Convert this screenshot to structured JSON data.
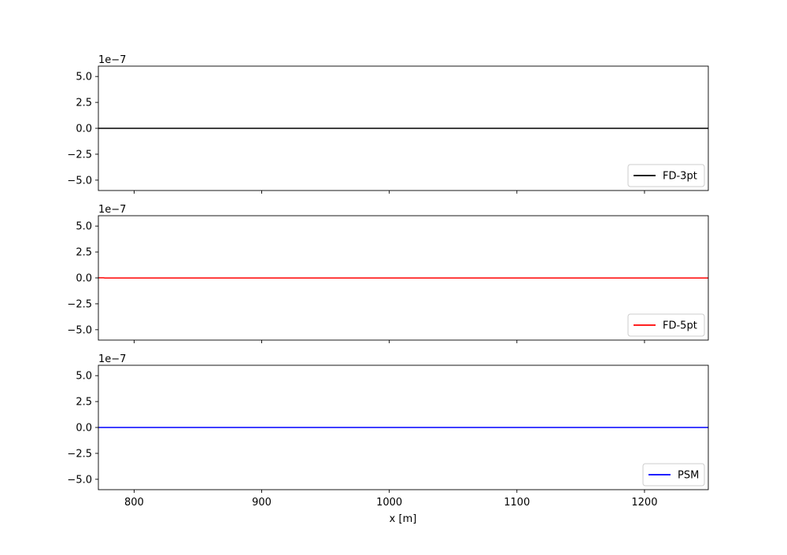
{
  "chart_data": {
    "type": "line",
    "layout": "3 vertically stacked subplots with shared x axis",
    "xlabel": "x [m]",
    "xlim": [
      772,
      1250
    ],
    "xticks": [
      800,
      900,
      1000,
      1100,
      1200
    ],
    "xtick_labels": [
      "800",
      "900",
      "1000",
      "1100",
      "1200"
    ],
    "grid": false,
    "subplots": [
      {
        "offset_text": "1e−7",
        "ylim": [
          -6e-07,
          6e-07
        ],
        "yticks": [
          5e-07,
          2.5e-07,
          0,
          -2.5e-07,
          -5e-07
        ],
        "ytick_labels": [
          "5.0",
          "2.5",
          "0.0",
          "−2.5",
          "−5.0"
        ],
        "legend_position": "lower right",
        "series": [
          {
            "name": "FD-3pt",
            "color": "#000000",
            "x": [
              772,
              1250
            ],
            "y": [
              0,
              0
            ]
          }
        ]
      },
      {
        "offset_text": "1e−7",
        "ylim": [
          -6e-07,
          6e-07
        ],
        "yticks": [
          5e-07,
          2.5e-07,
          0,
          -2.5e-07,
          -5e-07
        ],
        "ytick_labels": [
          "5.0",
          "2.5",
          "0.0",
          "−2.5",
          "−5.0"
        ],
        "legend_position": "lower right",
        "series": [
          {
            "name": "FD-5pt",
            "color": "#ff0000",
            "x": [
              772,
              776,
              777,
              1250
            ],
            "y": [
              1e-09,
              1e-09,
              -1e-09,
              -1e-09
            ]
          }
        ]
      },
      {
        "offset_text": "1e−7",
        "ylim": [
          -6e-07,
          6e-07
        ],
        "yticks": [
          5e-07,
          2.5e-07,
          0,
          -2.5e-07,
          -5e-07
        ],
        "ytick_labels": [
          "5.0",
          "2.5",
          "0.0",
          "−2.5",
          "−5.0"
        ],
        "legend_position": "lower right",
        "series": [
          {
            "name": "PSM",
            "color": "#0000ff",
            "x": [
              772,
              1250
            ],
            "y": [
              0,
              0
            ]
          }
        ]
      }
    ]
  }
}
